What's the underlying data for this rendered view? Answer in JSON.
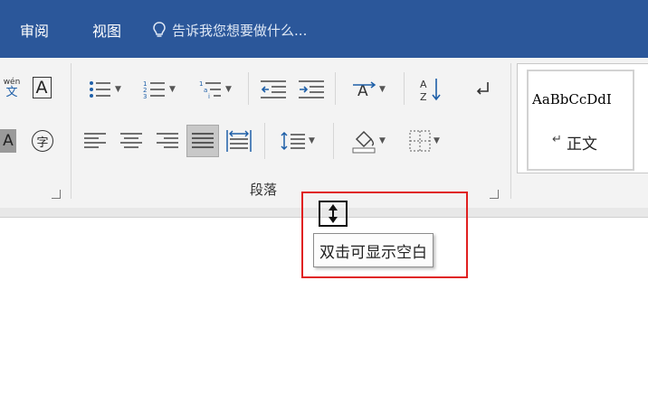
{
  "tabs": {
    "review": "审阅",
    "view": "视图"
  },
  "tell_me": {
    "text": "告诉我您想要做什么...",
    "icon": "lightbulb-icon"
  },
  "font_group": {
    "phonetic_top": "wén",
    "phonetic_char": "文",
    "char_border": "A",
    "char_shading": "A",
    "enclose_char": "字"
  },
  "paragraph_group": {
    "label": "段落"
  },
  "styles": {
    "sample": "AaBbCcDdI",
    "name": "正文",
    "mark": "↵"
  },
  "tooltip": {
    "text": "双击可显示空白"
  },
  "colors": {
    "title_bar": "#2b579a",
    "ribbon": "#f3f3f3",
    "highlight_box": "#e02020"
  }
}
